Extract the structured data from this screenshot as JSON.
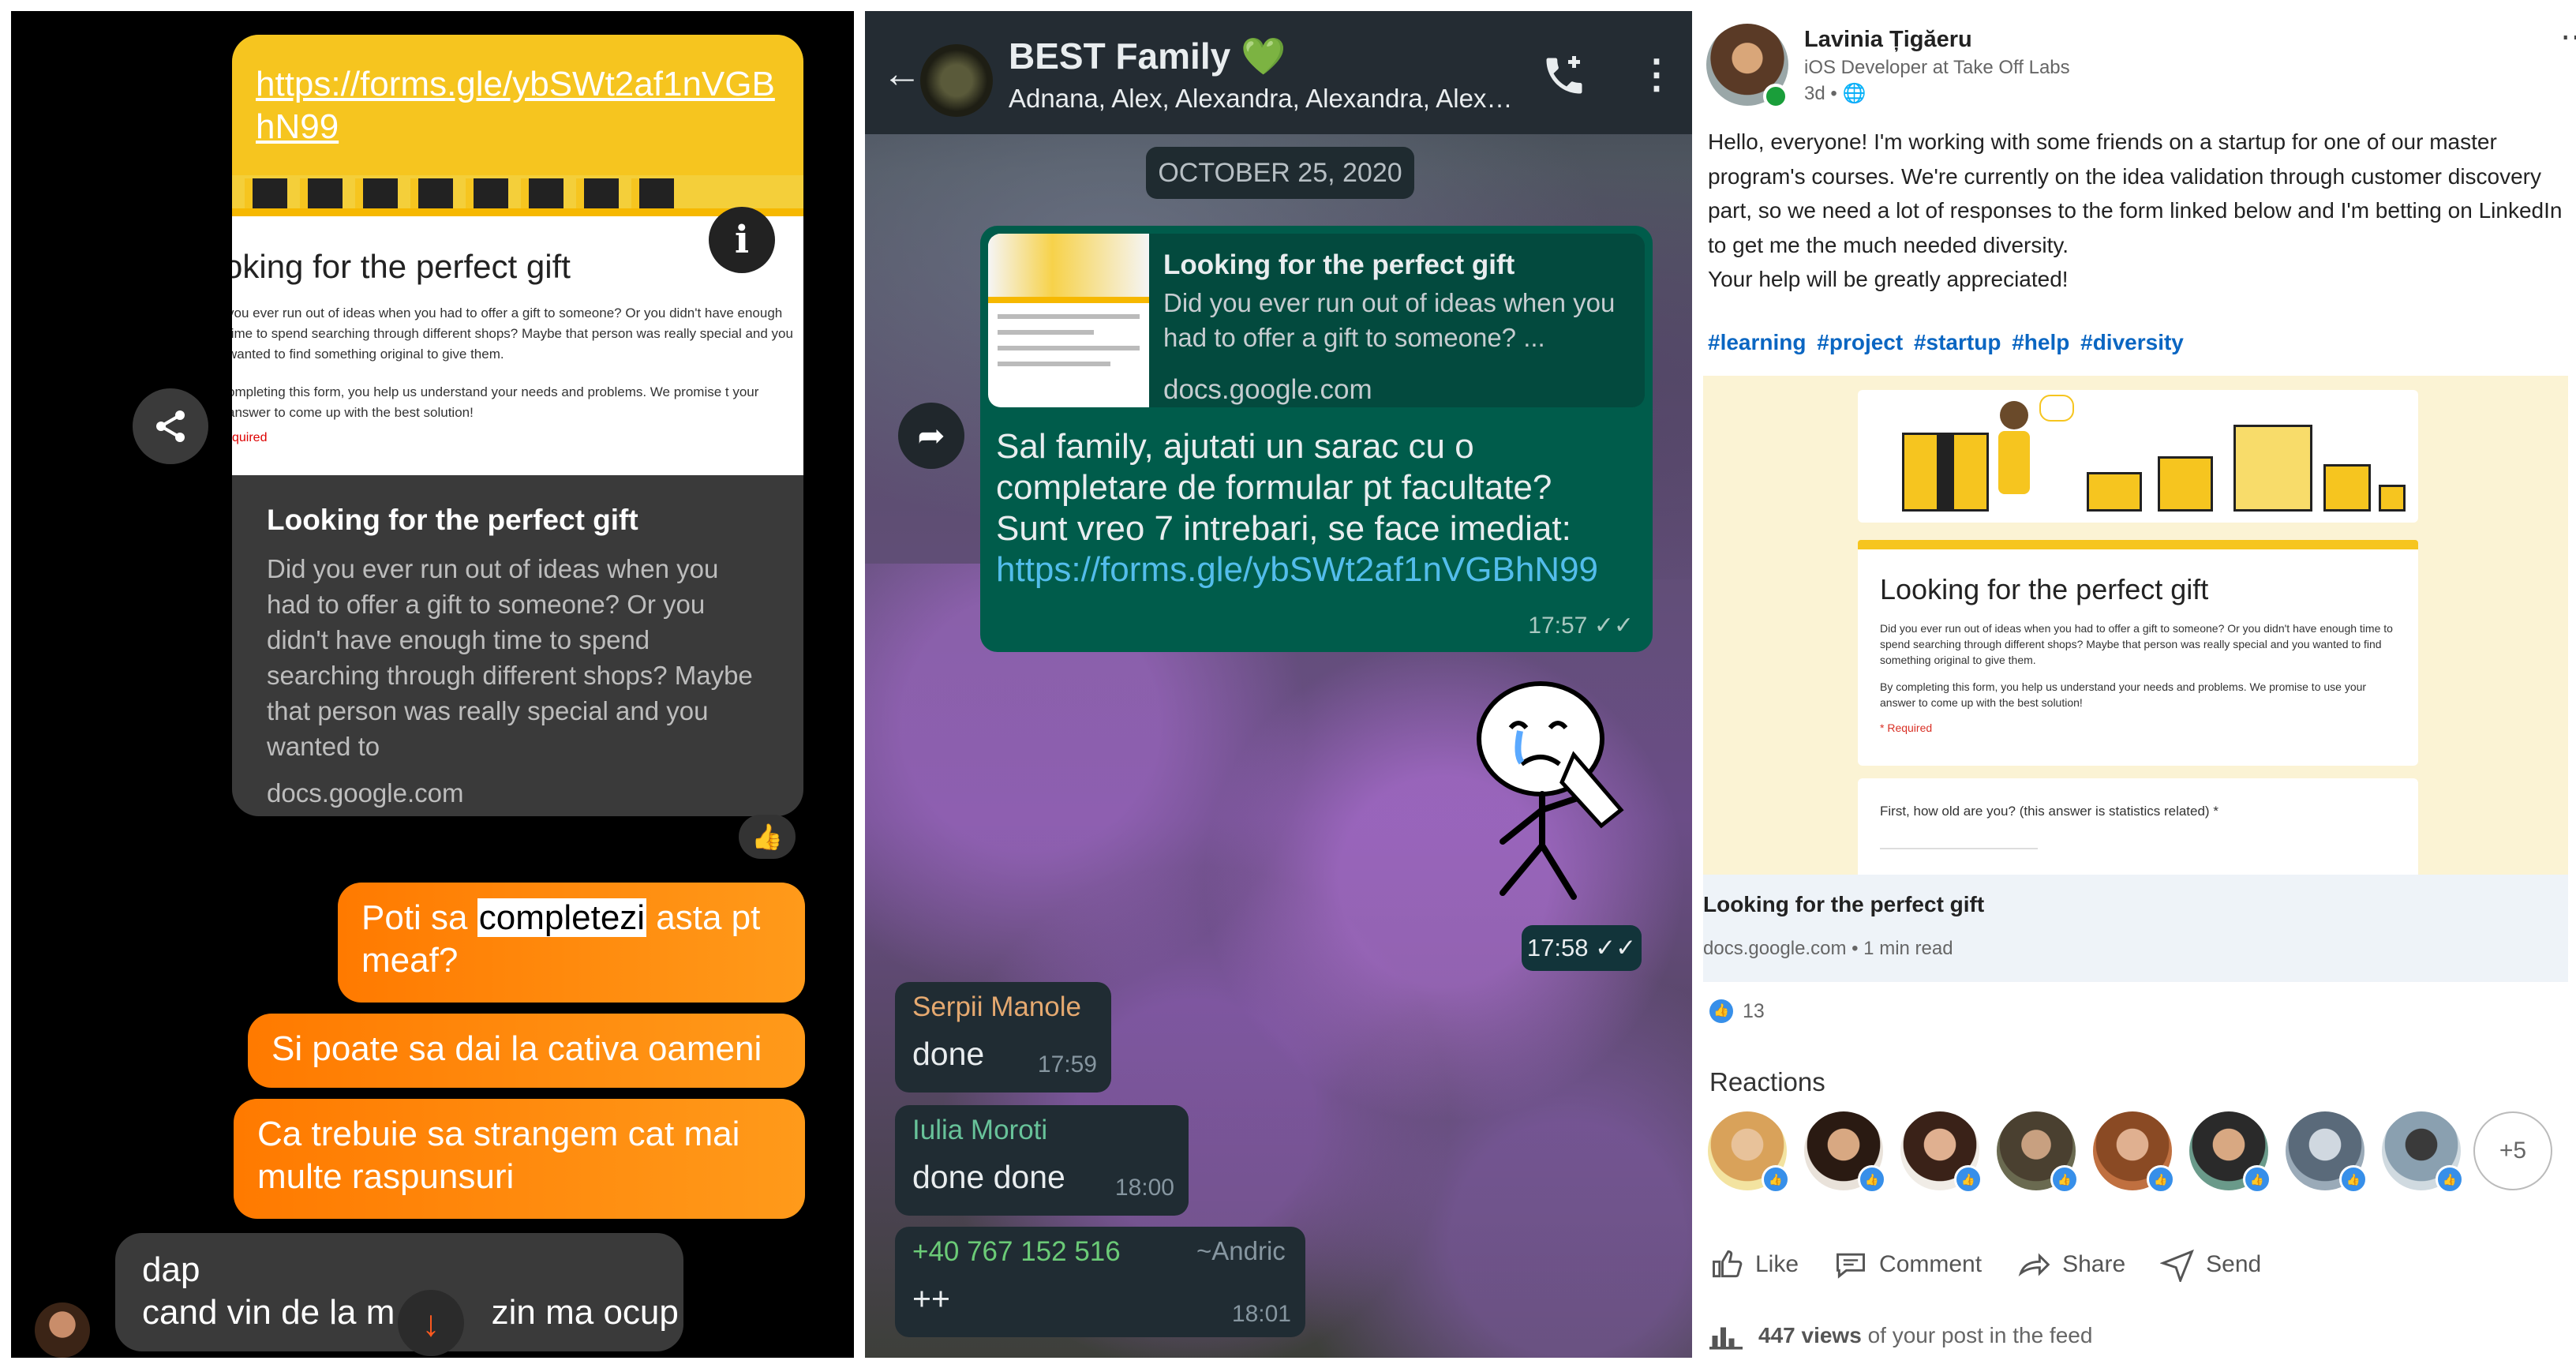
{
  "messenger": {
    "link_url": "https://forms.gle/ybSWt2af1nVGBhN99",
    "preview_title_clipped": "oking for the perfect gift",
    "preview_desc_clipped": "you ever run out of ideas when you had to offer a gift to someone? Or you didn't have enough time to spend searching through different shops? Maybe that person was really special and you wanted to find something original to give them.",
    "preview_desc2_clipped": "ompleting this form, you help us understand your needs and problems. We promise t your answer to come up with the best solution!",
    "preview_required_clipped": "quired",
    "card_title": "Looking for the perfect gift",
    "card_desc": "Did you ever run out of ideas when you had to offer a gift to someone? Or you didn't have enough time to spend searching through different shops? Maybe that person was really special and you wanted to",
    "card_domain": "docs.google.com",
    "reaction": "👍",
    "msg1_before": "Poti sa ",
    "msg1_highlight": "completezi",
    "msg1_after": " asta pt meaf?",
    "msg2": "Si poate sa dai la cativa oameni",
    "msg3": "Ca trebuie sa strangem cat mai multe raspunsuri",
    "reply_line1": "dap",
    "reply_line2": "cand vin de la m          zin ma ocup"
  },
  "whatsapp": {
    "title": "BEST Family",
    "title_emoji": "💚",
    "members": "Adnana, Alex, Alexandra, Alexandra, Alexa...",
    "date": "OCTOBER 25, 2020",
    "link_title": "Looking for the perfect gift",
    "link_desc": "Did you ever run out of ideas when you had to offer a gift to someone? ...",
    "link_domain": "docs.google.com",
    "message": "Sal family, ajutati un sarac cu o completare de formular pt facultate? Sunt vreo 7 intrebari, se face imediat:",
    "message_link": "https://forms.gle/ybSWt2af1nVGBhN99",
    "message_time": "17:57",
    "sticker_time": "17:58",
    "incoming": [
      {
        "sender": "Serpii Manole",
        "sender_color": "#e5a970",
        "text": "done",
        "time": "17:59",
        "extra": ""
      },
      {
        "sender": "Iulia Moroti",
        "sender_color": "#68c39a",
        "text": "done done",
        "time": "18:00",
        "extra": ""
      },
      {
        "sender": "+40 767 152 516",
        "sender_color": "#6bcb77",
        "text": "++",
        "time": "18:01",
        "extra": "~Andric"
      }
    ]
  },
  "linkedin": {
    "author": "Lavinia Țigăeru",
    "headline": "iOS Developer at Take Off Labs",
    "posted": "3d •",
    "body": "Hello, everyone! I'm working with some friends on a startup for one of our master program's courses. We're currently on the idea validation through customer discovery part, so we need a lot of responses to the form linked below and I'm betting on LinkedIn to get me the much needed diversity.",
    "body2": "Your help will be greatly appreciated!",
    "hashtags": "#learning #project #startup #help #diversity",
    "form_title": "Looking for the perfect gift",
    "form_desc": "Did you ever run out of ideas when you had to offer a gift to someone? Or you didn't have enough time to spend searching through different shops? Maybe that person was really special and you wanted to find something original to give them.",
    "form_desc2": "By completing this form, you help us understand your needs and problems. We promise to use your answer to come up with the best solution!",
    "form_required": "* Required",
    "form_question": "First, how old are you? (this answer is statistics related) *",
    "lp_title": "Looking for the perfect gift",
    "lp_sub": "docs.google.com • 1 min read",
    "reaction_count": "13",
    "reactions_heading": "Reactions",
    "more_reactors": "+5",
    "actions": {
      "like": "Like",
      "comment": "Comment",
      "share": "Share",
      "send": "Send"
    },
    "views_count": "447 views",
    "views_text": "of your post in the feed",
    "colors": {
      "link": "#0a66c2",
      "like": "#378fe9"
    }
  }
}
